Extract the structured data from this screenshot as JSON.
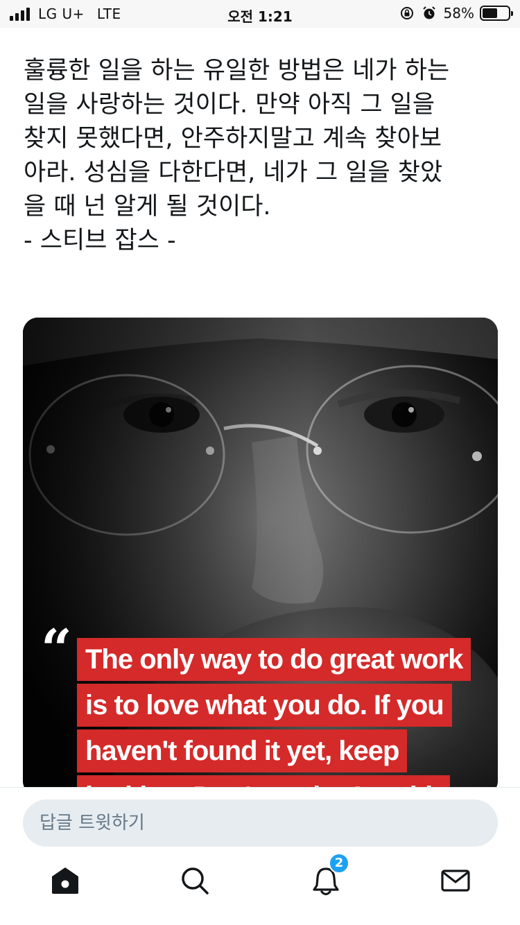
{
  "status_bar": {
    "carrier": "LG U+",
    "network": "LTE",
    "time": "오전 1:21",
    "battery_percent": "58%",
    "battery_level": 0.58,
    "icons": [
      "signal-icon",
      "rotation-lock-icon",
      "alarm-icon",
      "battery-icon"
    ]
  },
  "tweet": {
    "text_lines": [
      "훌륭한 일을 하는 유일한 방법은 네가 하는",
      "일을 사랑하는 것이다. 만약 아직 그 일을",
      "찾지 못했다면, 안주하지말고 계속 찾아보",
      "아라. 성심을 다한다면, 네가 그 일을 찾았",
      "을 때 넌 알게 될 것이다.",
      "- 스티브 잡스 -"
    ]
  },
  "media": {
    "quote_mark": "“",
    "quote_lines": [
      "The only way to do great work",
      "is to love what you do. If you",
      "haven't found it yet, keep",
      "looking. Don't settle. As with"
    ],
    "highlight_color": "#d42a2a"
  },
  "reply": {
    "placeholder": "답글 트윗하기"
  },
  "tab_bar": {
    "tabs": [
      "home-icon",
      "search-icon",
      "notifications-icon",
      "messages-icon"
    ],
    "notifications_badge": "2",
    "accent_color": "#1da1f2"
  }
}
